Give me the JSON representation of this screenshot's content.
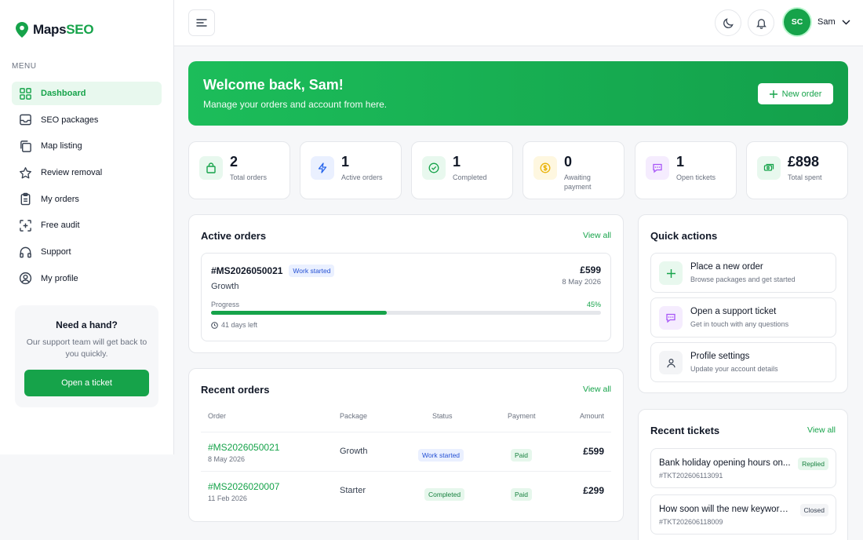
{
  "brand": {
    "maps": "Maps",
    "seo": "SEO"
  },
  "sidebar": {
    "menu_label": "MENU",
    "items": [
      {
        "label": "Dashboard",
        "icon": "grid-icon",
        "active": true
      },
      {
        "label": "SEO packages",
        "icon": "inbox-icon"
      },
      {
        "label": "Map listing",
        "icon": "copy-icon"
      },
      {
        "label": "Review removal",
        "icon": "star-icon"
      },
      {
        "label": "My orders",
        "icon": "clipboard-icon"
      },
      {
        "label": "Free audit",
        "icon": "scan-plus-icon"
      },
      {
        "label": "Support",
        "icon": "headphones-icon"
      },
      {
        "label": "My profile",
        "icon": "user-circle-icon"
      }
    ],
    "help": {
      "title": "Need a hand?",
      "text": "Our support team will get back to you quickly.",
      "button": "Open a ticket"
    }
  },
  "topbar": {
    "avatar_initials": "SC",
    "user_name": "Sam"
  },
  "hero": {
    "title": "Welcome back, Sam!",
    "subtitle": "Manage your orders and account from here.",
    "button": "New order"
  },
  "stats": [
    {
      "value": "2",
      "label": "Total orders",
      "icon": "bag-icon",
      "color": "#16a34a",
      "bg": "#e8f8ee"
    },
    {
      "value": "1",
      "label": "Active orders",
      "icon": "lightning-icon",
      "color": "#2563eb",
      "bg": "#eaf0ff"
    },
    {
      "value": "1",
      "label": "Completed",
      "icon": "check-circle-icon",
      "color": "#16a34a",
      "bg": "#e8f8ee"
    },
    {
      "value": "0",
      "label": "Awaiting payment",
      "icon": "coin-icon",
      "color": "#eab308",
      "bg": "#fef7e0"
    },
    {
      "value": "1",
      "label": "Open tickets",
      "icon": "message-icon",
      "color": "#a855f7",
      "bg": "#f5ecfe"
    },
    {
      "value": "£898",
      "label": "Total spent",
      "icon": "cash-icon",
      "color": "#16a34a",
      "bg": "#e8f8ee"
    }
  ],
  "active_orders": {
    "title": "Active orders",
    "view_all": "View all",
    "order": {
      "id": "#MS2026050021",
      "status": "Work started",
      "package": "Growth",
      "price": "£599",
      "date": "8 May 2026",
      "progress_label": "Progress",
      "progress_text": "45%",
      "progress": 0.45,
      "days_left": "41 days left"
    }
  },
  "recent_orders": {
    "title": "Recent orders",
    "view_all": "View all",
    "columns": [
      "Order",
      "Package",
      "Status",
      "Payment",
      "Amount"
    ],
    "rows": [
      {
        "id": "#MS2026050021",
        "date": "8 May 2026",
        "package": "Growth",
        "status": "Work started",
        "status_type": "blue",
        "payment": "Paid",
        "amount": "£599"
      },
      {
        "id": "#MS2026020007",
        "date": "11 Feb 2026",
        "package": "Starter",
        "status": "Completed",
        "status_type": "green",
        "payment": "Paid",
        "amount": "£299"
      }
    ]
  },
  "quick_actions": {
    "title": "Quick actions",
    "items": [
      {
        "title": "Place a new order",
        "subtitle": "Browse packages and get started",
        "icon": "plus-icon",
        "color": "#16a34a",
        "bg": "#e8f8ee"
      },
      {
        "title": "Open a support ticket",
        "subtitle": "Get in touch with any questions",
        "icon": "message-icon",
        "color": "#a855f7",
        "bg": "#f5ecfe"
      },
      {
        "title": "Profile settings",
        "subtitle": "Update your account details",
        "icon": "user-icon",
        "color": "#374151",
        "bg": "#f3f4f6"
      }
    ]
  },
  "recent_tickets": {
    "title": "Recent tickets",
    "view_all": "View all",
    "items": [
      {
        "title": "Bank holiday opening hours on...",
        "number": "#TKT202606113091",
        "status": "Replied",
        "status_type": "green"
      },
      {
        "title": "How soon will the new keywords...",
        "number": "#TKT202606118009",
        "status": "Closed",
        "status_type": "gray"
      }
    ]
  }
}
